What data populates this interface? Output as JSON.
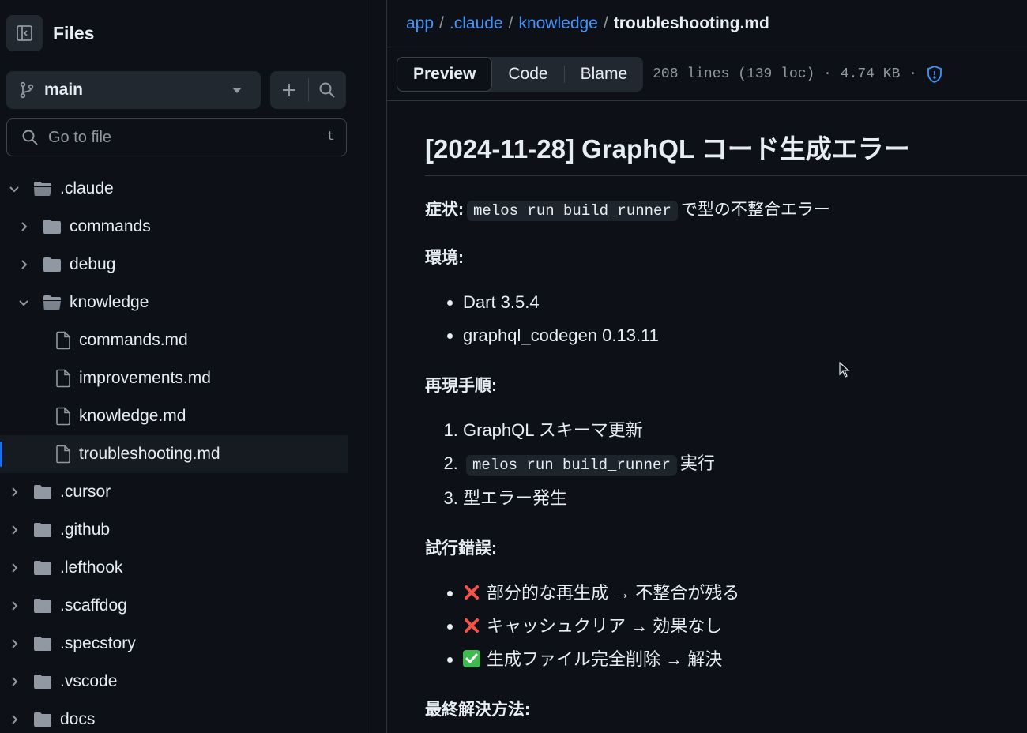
{
  "sidebar": {
    "title": "Files",
    "branch": "main",
    "goto_placeholder": "Go to file",
    "goto_shortcut": "t",
    "tree": [
      {
        "label": ".claude",
        "type": "folder",
        "expanded": true,
        "depth": 0
      },
      {
        "label": "commands",
        "type": "folder",
        "expanded": false,
        "depth": 1
      },
      {
        "label": "debug",
        "type": "folder",
        "expanded": false,
        "depth": 1
      },
      {
        "label": "knowledge",
        "type": "folder",
        "expanded": true,
        "depth": 1
      },
      {
        "label": "commands.md",
        "type": "file",
        "depth": 2
      },
      {
        "label": "improvements.md",
        "type": "file",
        "depth": 2
      },
      {
        "label": "knowledge.md",
        "type": "file",
        "depth": 2
      },
      {
        "label": "troubleshooting.md",
        "type": "file",
        "depth": 2,
        "selected": true
      },
      {
        "label": ".cursor",
        "type": "folder",
        "expanded": false,
        "depth": 0
      },
      {
        "label": ".github",
        "type": "folder",
        "expanded": false,
        "depth": 0
      },
      {
        "label": ".lefthook",
        "type": "folder",
        "expanded": false,
        "depth": 0
      },
      {
        "label": ".scaffdog",
        "type": "folder",
        "expanded": false,
        "depth": 0
      },
      {
        "label": ".specstory",
        "type": "folder",
        "expanded": false,
        "depth": 0
      },
      {
        "label": ".vscode",
        "type": "folder",
        "expanded": false,
        "depth": 0
      },
      {
        "label": "docs",
        "type": "folder",
        "expanded": false,
        "depth": 0
      }
    ]
  },
  "breadcrumb": {
    "parts": [
      "app",
      ".claude",
      "knowledge"
    ],
    "current": "troubleshooting.md",
    "separator": "/"
  },
  "toolbar": {
    "tabs": [
      "Preview",
      "Code",
      "Blame"
    ],
    "active_tab": "Preview",
    "meta": "208 lines (139 loc) · 4.74 KB ·"
  },
  "doc": {
    "title": "[2024-11-28] GraphQL コード生成エラー",
    "symptom_label": "症状:",
    "symptom_code": "melos run build_runner",
    "symptom_text": "で型の不整合エラー",
    "env_label": "環境:",
    "env_items": [
      "Dart 3.5.4",
      "graphql_codegen 0.13.11"
    ],
    "repro_label": "再現手順:",
    "repro_1": "GraphQL スキーマ更新",
    "repro_2_code": "melos run build_runner",
    "repro_2_text": "実行",
    "repro_3": "型エラー発生",
    "trials_label": "試行錯誤:",
    "trials": [
      {
        "status": "cross",
        "text": "部分的な再生成 → 不整合が残る"
      },
      {
        "status": "cross",
        "text": "キャッシュクリア → 効果なし"
      },
      {
        "status": "check",
        "text": "生成ファイル完全削除 → 解決"
      }
    ],
    "final_label": "最終解決方法:"
  },
  "colors": {
    "accent": "#4493f8",
    "bg": "#0d1117",
    "cross": "#f85149",
    "check": "#3fb950"
  }
}
